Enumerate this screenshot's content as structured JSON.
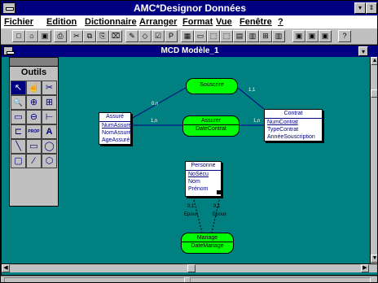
{
  "app": {
    "title": "AMC*Designor Données",
    "buttons": {
      "minimize": "▾",
      "restore": "⇕"
    }
  },
  "menu": {
    "items": [
      "Fichier",
      "Edition",
      "Dictionnaire",
      "Arranger",
      "Format",
      "Vue",
      "Fenêtre",
      "?"
    ]
  },
  "toolbar": {
    "icons": [
      "new-file",
      "open-file",
      "save",
      "print",
      "cut",
      "copy",
      "paste",
      "clear",
      "pencil",
      "eraser",
      "check-model",
      "parameters",
      "layout-1",
      "layout-2",
      "layout-3",
      "layout-4",
      "layout-5",
      "layout-6",
      "layout-7",
      "layout-8",
      "window-1",
      "window-2",
      "window-3",
      "help"
    ],
    "glyphs": [
      "□",
      "⌂",
      "▣",
      "⎙",
      "✂",
      "⧉",
      "⎘",
      "⌧",
      "✎",
      "◇",
      "☑",
      "P",
      "▦",
      "▭",
      "⬚",
      "⬚",
      "▤",
      "▥",
      "⊞",
      "▥",
      "▣",
      "▣",
      "▣",
      "?"
    ]
  },
  "child_window": {
    "title": "MCD Modèle_1"
  },
  "tools_palette": {
    "title": "Outils",
    "tools": [
      {
        "name": "pointer-tool-icon",
        "glyph": "↖"
      },
      {
        "name": "hand-tool-icon",
        "glyph": "☝"
      },
      {
        "name": "scissors-tool-icon",
        "glyph": "✂"
      },
      {
        "name": "zoom-tool-icon",
        "glyph": "🔍"
      },
      {
        "name": "zoom-fit-tool-icon",
        "glyph": "⊕"
      },
      {
        "name": "zoom-page-tool-icon",
        "glyph": "⊞"
      },
      {
        "name": "entity-tool-icon",
        "glyph": "▭"
      },
      {
        "name": "association-tool-icon",
        "glyph": "⊖"
      },
      {
        "name": "inheritance-tool-icon",
        "glyph": "⊢"
      },
      {
        "name": "link-tool-icon",
        "glyph": "⊏"
      },
      {
        "name": "properties-tool-icon",
        "glyph": "PROP"
      },
      {
        "name": "text-tool-icon",
        "glyph": "A"
      },
      {
        "name": "line-tool-icon",
        "glyph": "╲"
      },
      {
        "name": "rectangle-tool-icon",
        "glyph": "▭"
      },
      {
        "name": "ellipse-tool-icon",
        "glyph": "◯"
      },
      {
        "name": "rounded-rect-tool-icon",
        "glyph": "▢"
      },
      {
        "name": "polyline-tool-icon",
        "glyph": "∕"
      },
      {
        "name": "polygon-tool-icon",
        "glyph": "⬡"
      }
    ]
  },
  "model": {
    "entities": [
      {
        "key": "assure",
        "name": "Assuré",
        "attributes": [
          {
            "label": "NumAssuré",
            "id": true
          },
          {
            "label": "NomAssuré",
            "id": false
          },
          {
            "label": "AgeAssuré",
            "id": false
          }
        ]
      },
      {
        "key": "contrat",
        "name": "Contrat",
        "attributes": [
          {
            "label": "NumContrat",
            "id": true
          },
          {
            "label": "TypeContrat",
            "id": false
          },
          {
            "label": "AnnéeSouscription",
            "id": false
          }
        ]
      },
      {
        "key": "personne",
        "name": "Personne",
        "attributes": [
          {
            "label": "NoSécu",
            "id": true
          },
          {
            "label": "Nom",
            "id": false
          },
          {
            "label": "Prénom",
            "id": false
          }
        ]
      }
    ],
    "associations": [
      {
        "key": "souscrire",
        "name": "Souscrire",
        "attributes": []
      },
      {
        "key": "assurer",
        "name": "Assurer",
        "attributes": [
          "DateContrat"
        ]
      },
      {
        "key": "mariage",
        "name": "Mariage",
        "attributes": [
          "DateMariage"
        ]
      }
    ],
    "cardinalities": {
      "assure_souscrire": "0,n",
      "souscrire_contrat": "1,1",
      "assure_assurer": "1,n",
      "assurer_contrat": "1,n",
      "personne_mariage_left": "0,1",
      "personne_mariage_right": "0,1",
      "role_left": "Epoux",
      "role_right": "Epoux"
    }
  },
  "colors": {
    "title_bar": "#000080",
    "canvas": "#008080",
    "association_fill": "#00ff00",
    "entity_fill": "#ffffff",
    "link": "#000080"
  }
}
